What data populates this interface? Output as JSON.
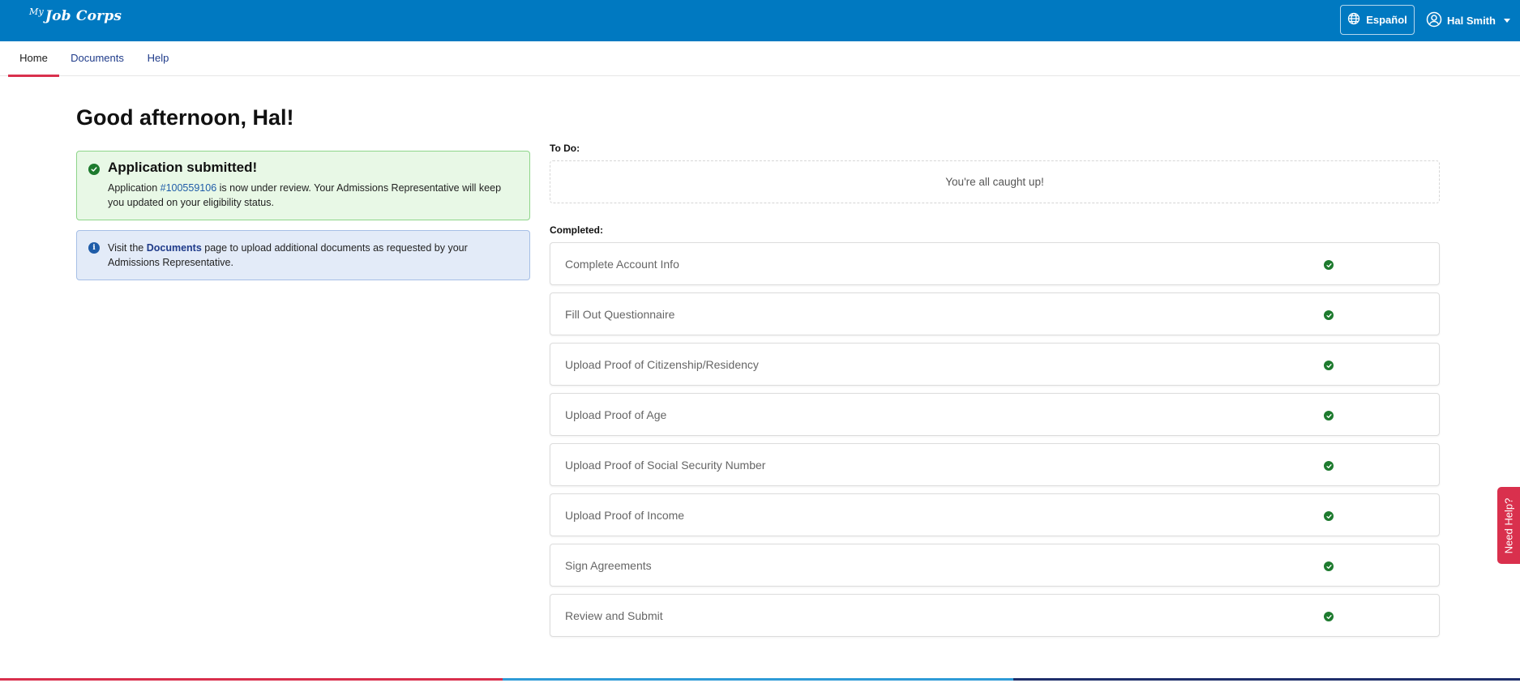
{
  "header": {
    "logo_prefix": "My",
    "logo_text": "Job Corps",
    "language_button": "Español",
    "user_name": "Hal Smith",
    "colors": {
      "bar": "#0079c1",
      "accent": "#d9304d"
    }
  },
  "nav": {
    "tabs": [
      {
        "label": "Home",
        "active": true
      },
      {
        "label": "Documents",
        "active": false
      },
      {
        "label": "Help",
        "active": false
      }
    ]
  },
  "greeting": "Good afternoon, Hal!",
  "alerts": {
    "success": {
      "title": "Application submitted!",
      "text_before": "Application ",
      "application_number": "#100559106",
      "text_after": " is now under review. Your Admissions Representative will keep you updated on your eligibility status."
    },
    "info": {
      "text_before": "Visit the ",
      "link": "Documents",
      "text_after": " page to upload additional documents as requested by your Admissions Representative."
    }
  },
  "todo": {
    "label": "To Do:",
    "empty_message": "You're all caught up!"
  },
  "completed": {
    "label": "Completed:",
    "items": [
      {
        "label": "Complete Account Info",
        "status_icon": "check-circle-icon"
      },
      {
        "label": "Fill Out Questionnaire",
        "status_icon": "check-circle-icon"
      },
      {
        "label": "Upload Proof of Citizenship/Residency",
        "status_icon": "check-circle-icon"
      },
      {
        "label": "Upload Proof of Age",
        "status_icon": "check-circle-icon"
      },
      {
        "label": "Upload Proof of Social Security Number",
        "status_icon": "check-circle-icon"
      },
      {
        "label": "Upload Proof of Income",
        "status_icon": "check-circle-icon"
      },
      {
        "label": "Sign Agreements",
        "status_icon": "check-circle-icon"
      },
      {
        "label": "Review and Submit",
        "status_icon": "check-circle-icon"
      }
    ]
  },
  "need_help": "Need Help?"
}
